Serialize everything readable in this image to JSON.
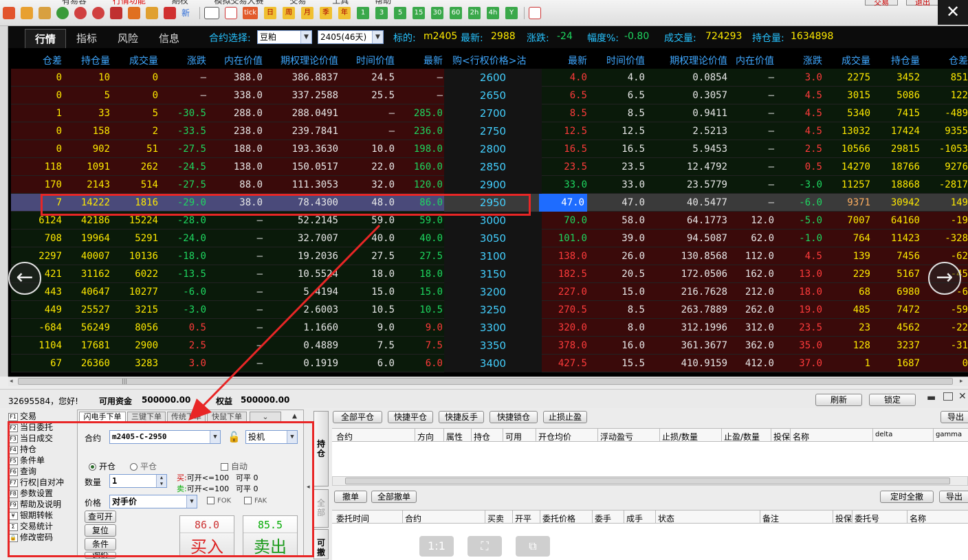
{
  "menu": [
    "有易容",
    "行情功能",
    "期权",
    "模拟交易大赛",
    "交易",
    "工具",
    "帮助"
  ],
  "top_buttons": [
    "交易",
    "退出"
  ],
  "close_glyph": "✕",
  "toolbar_keys": [
    "tick",
    "日",
    "周",
    "月",
    "季",
    "年",
    "1",
    "3",
    "5",
    "15",
    "30",
    "60",
    "2h",
    "4h",
    "Y"
  ],
  "toolbar_new_label": "新",
  "quote": {
    "tabs": [
      "行情",
      "指标",
      "风险",
      "信息"
    ],
    "contract_label": "合约选择:",
    "contract_value": "豆粕",
    "month_value": "2405(46天)",
    "underlying_label": "标的:",
    "underlying_value": "m2405",
    "last_label": "最新:",
    "last_value": "2988",
    "change_label": "涨跌:",
    "change_value": "-24",
    "pct_label": "幅度%:",
    "pct_value": "-0.80",
    "volume_label": "成交量:",
    "volume_value": "724293",
    "oi_label": "持仓量:",
    "oi_value": "1634898"
  },
  "columns": {
    "call": [
      "仓差",
      "持仓量",
      "成交量",
      "涨跌",
      "内在价值",
      "期权理论价值",
      "时间价值",
      "最新"
    ],
    "strike": "购<行权价格>沽",
    "put": [
      "最新",
      "时间价值",
      "期权理论价值",
      "内在价值",
      "涨跌",
      "成交量",
      "持仓量",
      "仓差"
    ]
  },
  "rows": [
    {
      "c": [
        "0",
        "10",
        "0",
        "—",
        "388.0",
        "386.8837",
        "24.5",
        "—"
      ],
      "k": "2600",
      "p": [
        "4.0",
        "4.0",
        "0.0854",
        "—",
        "3.0",
        "2275",
        "3452",
        "851"
      ]
    },
    {
      "c": [
        "0",
        "5",
        "0",
        "—",
        "338.0",
        "337.2588",
        "25.5",
        "—"
      ],
      "k": "2650",
      "p": [
        "6.5",
        "6.5",
        "0.3057",
        "—",
        "4.5",
        "3015",
        "5086",
        "122"
      ]
    },
    {
      "c": [
        "1",
        "33",
        "5",
        "-30.5",
        "288.0",
        "288.0491",
        "—",
        "285.0"
      ],
      "k": "2700",
      "p": [
        "8.5",
        "8.5",
        "0.9411",
        "—",
        "4.5",
        "5340",
        "7415",
        "-489"
      ]
    },
    {
      "c": [
        "0",
        "158",
        "2",
        "-33.5",
        "238.0",
        "239.7841",
        "—",
        "236.0"
      ],
      "k": "2750",
      "p": [
        "12.5",
        "12.5",
        "2.5213",
        "—",
        "4.5",
        "13032",
        "17424",
        "9355"
      ]
    },
    {
      "c": [
        "0",
        "902",
        "51",
        "-27.5",
        "188.0",
        "193.3630",
        "10.0",
        "198.0"
      ],
      "k": "2800",
      "p": [
        "16.5",
        "16.5",
        "5.9453",
        "—",
        "2.5",
        "10566",
        "29815",
        "-1053"
      ]
    },
    {
      "c": [
        "118",
        "1091",
        "262",
        "-24.5",
        "138.0",
        "150.0517",
        "22.0",
        "160.0"
      ],
      "k": "2850",
      "p": [
        "23.5",
        "23.5",
        "12.4792",
        "—",
        "0.5",
        "14270",
        "18766",
        "9276"
      ]
    },
    {
      "c": [
        "170",
        "2143",
        "514",
        "-27.5",
        "88.0",
        "111.3053",
        "32.0",
        "120.0"
      ],
      "k": "2900",
      "p": [
        "33.0",
        "33.0",
        "23.5779",
        "—",
        "-3.0",
        "11257",
        "18868",
        "-2817"
      ]
    },
    {
      "c": [
        "7",
        "14222",
        "1816",
        "-29.0",
        "38.0",
        "78.4300",
        "48.0",
        "86.0"
      ],
      "k": "2950",
      "p": [
        "47.0",
        "47.0",
        "40.5477",
        "—",
        "-6.0",
        "9371",
        "30942",
        "149"
      ]
    },
    {
      "c": [
        "6124",
        "42186",
        "15224",
        "-28.0",
        "—",
        "52.2145",
        "59.0",
        "59.0"
      ],
      "k": "3000",
      "p": [
        "70.0",
        "58.0",
        "64.1773",
        "12.0",
        "-5.0",
        "7007",
        "64160",
        "-19"
      ]
    },
    {
      "c": [
        "708",
        "19964",
        "5291",
        "-24.0",
        "—",
        "32.7007",
        "40.0",
        "40.0"
      ],
      "k": "3050",
      "p": [
        "101.0",
        "39.0",
        "94.5087",
        "62.0",
        "-1.0",
        "764",
        "11423",
        "-328"
      ]
    },
    {
      "c": [
        "2297",
        "40007",
        "10136",
        "-18.0",
        "—",
        "19.2036",
        "27.5",
        "27.5"
      ],
      "k": "3100",
      "p": [
        "138.0",
        "26.0",
        "130.8568",
        "112.0",
        "4.5",
        "139",
        "7456",
        "-62"
      ]
    },
    {
      "c": [
        "421",
        "31162",
        "6022",
        "-13.5",
        "—",
        "10.5524",
        "18.0",
        "18.0"
      ],
      "k": "3150",
      "p": [
        "182.5",
        "20.5",
        "172.0506",
        "162.0",
        "13.0",
        "229",
        "5167",
        "-45"
      ]
    },
    {
      "c": [
        "443",
        "40647",
        "10277",
        "-6.0",
        "—",
        "5.4194",
        "15.0",
        "15.0"
      ],
      "k": "3200",
      "p": [
        "227.0",
        "15.0",
        "216.7628",
        "212.0",
        "18.0",
        "68",
        "6980",
        "-6"
      ]
    },
    {
      "c": [
        "449",
        "25527",
        "3215",
        "-3.0",
        "—",
        "2.6003",
        "10.5",
        "10.5"
      ],
      "k": "3250",
      "p": [
        "270.5",
        "8.5",
        "263.7889",
        "262.0",
        "19.0",
        "485",
        "7472",
        "-59"
      ]
    },
    {
      "c": [
        "-684",
        "56249",
        "8056",
        "0.5",
        "—",
        "1.1660",
        "9.0",
        "9.0"
      ],
      "k": "3300",
      "p": [
        "320.0",
        "8.0",
        "312.1996",
        "312.0",
        "23.5",
        "23",
        "4562",
        "-22"
      ]
    },
    {
      "c": [
        "1104",
        "17681",
        "2900",
        "2.5",
        "—",
        "0.4889",
        "7.5",
        "7.5"
      ],
      "k": "3350",
      "p": [
        "378.0",
        "16.0",
        "361.3677",
        "362.0",
        "35.0",
        "128",
        "3237",
        "-31"
      ]
    },
    {
      "c": [
        "67",
        "26360",
        "3283",
        "3.0",
        "—",
        "0.1919",
        "6.0",
        "6.0"
      ],
      "k": "3400",
      "p": [
        "427.5",
        "15.5",
        "410.9159",
        "412.0",
        "37.0",
        "1",
        "1687",
        "0"
      ]
    }
  ],
  "selected_strike": "2950",
  "nav": {
    "left": "←",
    "right": "→",
    "scroll_mark": "|||"
  },
  "status": {
    "greeting": "32695584，您好!",
    "funds_label": "可用资金",
    "funds_value": "500000.00",
    "equity_label": "权益",
    "equity_value": "500000.00",
    "refresh": "刷新",
    "lock": "锁定"
  },
  "functions": [
    {
      "key": "F1",
      "label": "交易"
    },
    {
      "key": "F2",
      "label": "当日委托"
    },
    {
      "key": "F3",
      "label": "当日成交"
    },
    {
      "key": "F4",
      "label": "持仓"
    },
    {
      "key": "F5",
      "label": "条件单"
    },
    {
      "key": "F6",
      "label": "查询"
    },
    {
      "key": "F7",
      "label": "行权|自对冲"
    },
    {
      "key": "F8",
      "label": "参数设置"
    },
    {
      "key": "F9",
      "label": "帮助及说明"
    },
    {
      "key": "¥",
      "label": "银期转帐"
    },
    {
      "key": "Σ",
      "label": "交易统计"
    },
    {
      "key": "🔒",
      "label": "修改密码"
    }
  ],
  "order": {
    "tabs": [
      "闪电手下单",
      "三键下单",
      "传统下单",
      "快鼠下单"
    ],
    "contract_label": "合约",
    "contract_value": "m2405-C-2950",
    "hedge_value": "投机",
    "open_label": "开仓",
    "close_label": "平仓",
    "auto_label": "自动",
    "qty_label": "数量",
    "qty_value": "1",
    "buy_info_prefix": "买:",
    "buy_info": "可开<=100",
    "buy_close": "可平 0",
    "sell_info_prefix": "卖:",
    "sell_info": "可开<=100",
    "sell_close": "可平 0",
    "price_label": "价格",
    "price_value": "对手价",
    "fok": "FOK",
    "fak": "FAK",
    "btn_query": "查可开",
    "btn_reset": "复位",
    "btn_cond": "条件",
    "btn_ask": "询价",
    "buy_price": "86.0",
    "buy_label": "买入",
    "sell_price": "85.5",
    "sell_label": "卖出"
  },
  "side_tabs": [
    "持仓",
    "全部",
    "可撤"
  ],
  "positions": {
    "buttons": [
      "全部平仓",
      "快捷平仓",
      "快捷反手",
      "快捷锁仓",
      "止损止盈"
    ],
    "export": "导出",
    "columns": [
      "合约",
      "方向",
      "属性",
      "持仓",
      "可用",
      "开仓均价",
      "浮动盈亏",
      "止损/数量",
      "止盈/数量",
      "投保",
      "名称",
      "delta",
      "gamma"
    ]
  },
  "orders": {
    "buttons": [
      "撤单",
      "全部撤单"
    ],
    "timed_cancel": "定时全撤",
    "export": "导出",
    "columns": [
      "委托时间",
      "合约",
      "买卖",
      "开平",
      "委托价格",
      "委手",
      "成手",
      "状态",
      "备注",
      "投保",
      "委托号",
      "名称"
    ]
  },
  "view_icons": [
    "1:1",
    "⛶",
    "⧉"
  ],
  "colors": {
    "up": "#ff3b3b",
    "down": "#1ed760",
    "yellow": "#ffea00",
    "cyan": "#44d0ff",
    "highlight": "#e82626"
  }
}
